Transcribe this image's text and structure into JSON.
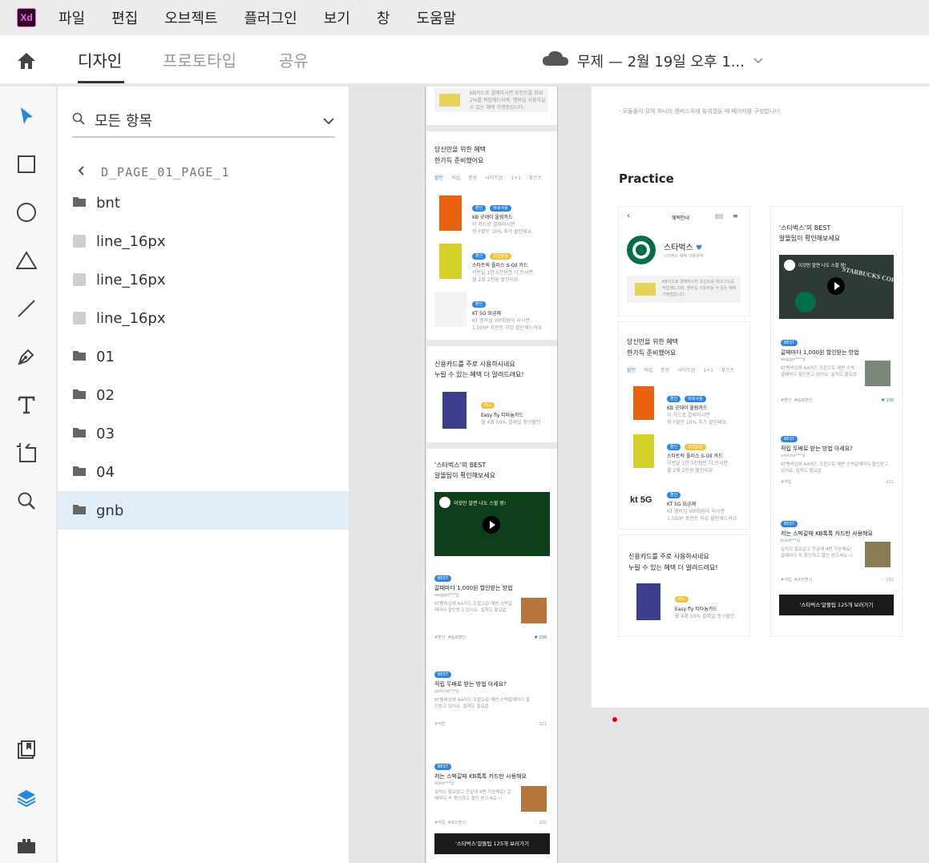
{
  "menubar": {
    "logo": "Xd",
    "items": [
      "파일",
      "편집",
      "오브젝트",
      "플러그인",
      "보기",
      "창",
      "도움말"
    ]
  },
  "toolbar": {
    "tabs": [
      "디자인",
      "프로토타입",
      "공유"
    ],
    "active_tab": "디자인",
    "doc_title": "무제 — 2월 19일 오후 1..."
  },
  "tools": [
    "select-icon",
    "rectangle-icon",
    "ellipse-icon",
    "polygon-icon",
    "line-icon",
    "pen-icon",
    "text-icon",
    "artboard-icon",
    "zoom-icon",
    "assets-icon",
    "layers-icon",
    "plugins-icon"
  ],
  "layers": {
    "search_placeholder": "모든 항목",
    "breadcrumb": "D_PAGE_01_PAGE_1",
    "items": [
      {
        "label": "bnt",
        "type": "folder"
      },
      {
        "label": "line_16px",
        "type": "shape"
      },
      {
        "label": "line_16px",
        "type": "shape"
      },
      {
        "label": "line_16px",
        "type": "shape"
      },
      {
        "label": "01",
        "type": "folder"
      },
      {
        "label": "02",
        "type": "folder"
      },
      {
        "label": "03",
        "type": "folder"
      },
      {
        "label": "04",
        "type": "folder"
      },
      {
        "label": "gnb",
        "type": "folder",
        "selected": true
      }
    ]
  },
  "phone": {
    "top_note": "KB카드로 결제하시면 포인트를 최대 2%를 적립해드리며, 멤버십 사용하실 수 있는 혜택 가맹점입니다.",
    "benefit_title_1": "당신만을 위한 혜택",
    "benefit_title_2": "한가득 준비했어요",
    "benefit_tabs": [
      "할인",
      "적립",
      "증정",
      "사이즈업",
      "1+1",
      "포인트"
    ],
    "offers": [
      {
        "tags": [
          "할인",
          "바로사용"
        ],
        "name": "KB 굿데이 올림카드",
        "desc1": "이 카드로 결제하시면",
        "desc2": "청구할인 10% 추가 할인돼요."
      },
      {
        "tags": [
          "할인",
          "조건달성"
        ],
        "name": "스타트릭 플러스 S-Oil 카드",
        "desc1": "이번달 1만 5천원만 더 쓰시면",
        "desc2": "월 2회 2천원 할인되요"
      },
      {
        "tags": [
          "할인"
        ],
        "name": "KT 5G 요금제",
        "desc1": "KT 멤버십 VIP회원이 되시면",
        "desc2": "1,500P 포인트 차감 할인해드려요"
      }
    ],
    "credit_title_1": "신용카드를 주로 사용하시네요",
    "credit_title_2": "누릴 수 있는 혜택 더 알려드려요!",
    "credit_card": {
      "tag": "카드",
      "name": "Easy fly 티타늄카드",
      "desc": "월 4회 50% 결제일 청구할인"
    },
    "tips_title_1": "'스타벅스'의 BEST",
    "tips_title_2": "알뜰팁이 확인해보세요",
    "video_caption": "이것만 알면 나도 스할 왕!",
    "tips": [
      {
        "badge": "BEST",
        "title": "갈때마다 1,000원 할인받는 방법",
        "author": "wegger***님",
        "desc": "KT멤버십에 AA카드 조합으로 매번 스벅갈때마다 할인받고 있어요. 실적도 필요없",
        "tags": [
          "#할인",
          "#음료할인"
        ],
        "likes": "298"
      },
      {
        "badge": "BEST",
        "title": "적립 두배로 받는 방법 아세요?",
        "author": "yrikune***님",
        "desc": "KT멤버십에 AA카드 조합으로 매번 스벅갈때마다 할인받고 있어요. 실적도 필요없",
        "tags": [
          "#적립"
        ],
        "likes": "121"
      },
      {
        "badge": "BEST",
        "title": "저는 스벅갈때 KB톡톡 카드만 사용해요",
        "author": "bijed***님",
        "desc": "실적도 필요없고 한달에 4번 가능해요! 갈때마다 꼭 확인하고 할인 받으세요~!",
        "tags": [
          "#적립",
          "#프리퀀시"
        ],
        "likes": "102"
      }
    ],
    "more_button": "'스타벅스'알뜰팁 125개 보러가기"
  },
  "board": {
    "note": "- 모듈들이 모여 하나의 캔버스위에 놓여졌을 때 페이지를 구성합니다.",
    "practice_title": "Practice",
    "header_title": "혜택안내",
    "brand_name": "스타벅스",
    "brand_sub": "스타벅스 혜택 이용내역",
    "kt_logo": "kt 5G",
    "video_brand": "STARBUCKS COFFEE"
  }
}
